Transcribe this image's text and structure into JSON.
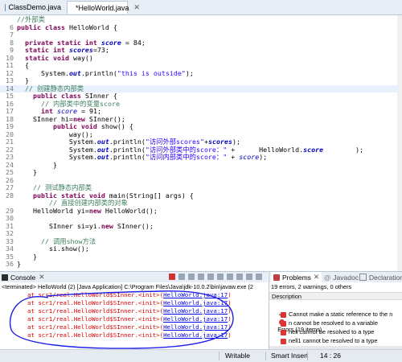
{
  "tabs": [
    {
      "label": "ClassDemo.java",
      "active": false
    },
    {
      "label": "*HelloWorld.java",
      "active": true
    }
  ],
  "editor": {
    "lines": [
      {
        "n": "",
        "html": "<span class='cm'>//外部类</span>"
      },
      {
        "n": "6",
        "html": "<span class='kw'>public class</span> HelloWorld {"
      },
      {
        "n": "7",
        "html": ""
      },
      {
        "n": "8",
        "html": "  <span class='kw'>private static int</span> <span class='sf'>score</span> = 84;"
      },
      {
        "n": "9",
        "html": "  <span class='kw'>static int</span> <span class='sf'>scores</span>=73;"
      },
      {
        "n": "10",
        "html": "  <span class='kw'>static void</span> way()"
      },
      {
        "n": "11",
        "html": "  {"
      },
      {
        "n": "12",
        "html": "      System.<span class='sf'>out</span>.println(<span class='st'>\"this is outside\"</span>);"
      },
      {
        "n": "13",
        "html": "  }"
      },
      {
        "n": "14",
        "html": "  <span class='cm'>// 创建静态内部类</span>"
      },
      {
        "n": "15",
        "html": "    <span class='kw'>public class</span> SInner {"
      },
      {
        "n": "16",
        "html": "      <span class='cm'>// 内部类中的变量score</span>"
      },
      {
        "n": "17",
        "html": "      <span class='kw'>int</span> <span class='fi'>score</span> = 91;"
      },
      {
        "n": "18",
        "html": "    SInner hi=<span class='kw'>new</span> SInner();"
      },
      {
        "n": "19",
        "html": "         <span class='kw'>public void</span> show() {"
      },
      {
        "n": "20",
        "html": "             way();"
      },
      {
        "n": "21",
        "html": "             System.<span class='sf'>out</span>.println(<span class='st'>\"访问外部scores\"</span>+<span class='sf'>scores</span>);"
      },
      {
        "n": "22",
        "html": "             System.<span class='sf'>out</span>.println(<span class='st'>\"访问外部类中的score：\"</span> +      HelloWorld.<span class='sf'>score</span>        );"
      },
      {
        "n": "23",
        "html": "             System.<span class='sf'>out</span>.println(<span class='st'>\"访问内部类中的score：\"</span> + <span class='fi'>score</span>);"
      },
      {
        "n": "24",
        "html": "         }"
      },
      {
        "n": "25",
        "html": "    }"
      },
      {
        "n": "26",
        "html": ""
      },
      {
        "n": "27",
        "html": "    <span class='cm'>// 测试静态内部类</span>"
      },
      {
        "n": "28",
        "html": "    <span class='kw'>public static void</span> main(String[] args) {"
      },
      {
        "n": "",
        "html": "        <span class='cm'>// 直接创建内部类的对象</span>"
      },
      {
        "n": "29",
        "html": "    HelloWorld yi=<span class='kw'>new</span> HelloWorld();"
      },
      {
        "n": "30",
        "html": ""
      },
      {
        "n": "31",
        "html": "        SInner si=yi.<span class='kw'>new</span> SInner();"
      },
      {
        "n": "32",
        "html": ""
      },
      {
        "n": "33",
        "html": "      <span class='cm'>// 调用show方法</span>"
      },
      {
        "n": "34",
        "html": "        si.show();"
      },
      {
        "n": "35",
        "html": "    }"
      },
      {
        "n": "36",
        "html": "}"
      }
    ]
  },
  "console": {
    "tab_label": "Console",
    "header": "<terminated> HelloWorld (2) [Java Application] C:\\Program Files\\Java\\jdk-10.0.2\\bin\\javaw.exe (2",
    "stack_prefix": "at scr1/real.HelloWorld$SInner.<init>(",
    "stack_link": "HelloWorld.java:17",
    "stack_suffix": ")",
    "stack_count": 6
  },
  "problems": {
    "tabs": [
      "Problems",
      "Javadoc",
      "Declaration"
    ],
    "summary": "19 errors, 2 warnings, 0 others",
    "col_header": "Description",
    "group": "Errors (19 items)",
    "items": [
      "Cannot make a static reference to the n",
      "n cannot be resolved to a variable",
      "nell cannot be resolved to a type",
      "nell1 cannot be resolved to a type"
    ]
  },
  "status": {
    "writable": "Writable",
    "insert_mode": "Smart Insert",
    "position": "14 : 26"
  },
  "colors": {
    "error": "#e00000",
    "link": "#0000ee",
    "annotation": "#1e1ee6"
  }
}
